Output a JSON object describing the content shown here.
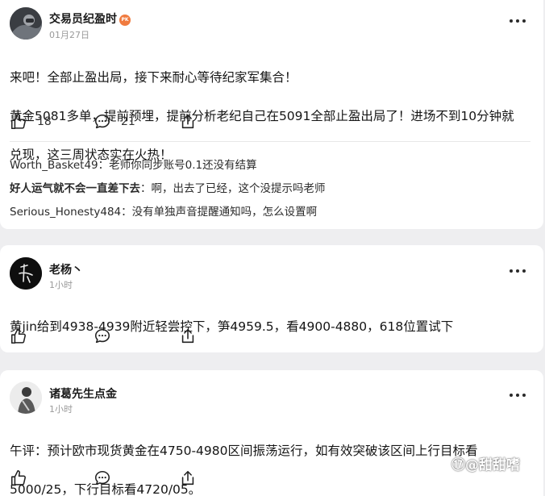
{
  "posts": [
    {
      "author": "交易员纪盈时",
      "badge": "PK",
      "time": "01月27日",
      "lines": [
        "来吧！全部止盈出局，接下来耐心等待纪家军集合！",
        "黄金5081多单，提前预埋，提前分析老纪自己在5091全部止盈出局了！进场不到10分钟就",
        "兑现，这三周状态实在火热！"
      ],
      "likes": "18",
      "comments_count": "21",
      "comments": [
        {
          "name": "Worth_Basket49",
          "sep": "：",
          "text": "老师你同步账号0.1还没有结算",
          "bold": false
        },
        {
          "name": "好人运气就不会一直差下去",
          "sep": "：",
          "text": "啊，出去了已经，这个没提示吗老师",
          "bold": true
        },
        {
          "name": "Serious_Honesty484",
          "sep": "：",
          "text": "没有单独声音提醒通知吗，怎么设置啊",
          "bold": false
        }
      ]
    },
    {
      "author": "老杨丶",
      "time": "1小时",
      "lines": [
        "黄jin给到4938-4939附近轻尝控下，笋4959.5，看4900-4880，618位置试下"
      ]
    },
    {
      "author": "诸葛先生点金",
      "time": "1小时",
      "lines": [
        "午评：预计欧市现货黄金在4750-4980区间振荡运行，如有效突破该区间上行目标看",
        "5000/25，下行目标看4720/05。"
      ]
    }
  ],
  "watermark": "⑰@甜甜嗜",
  "colors": {
    "background": "#eeeef0",
    "card": "#ffffff",
    "badge": "#f07b3f",
    "muted": "#9a9a9a"
  }
}
